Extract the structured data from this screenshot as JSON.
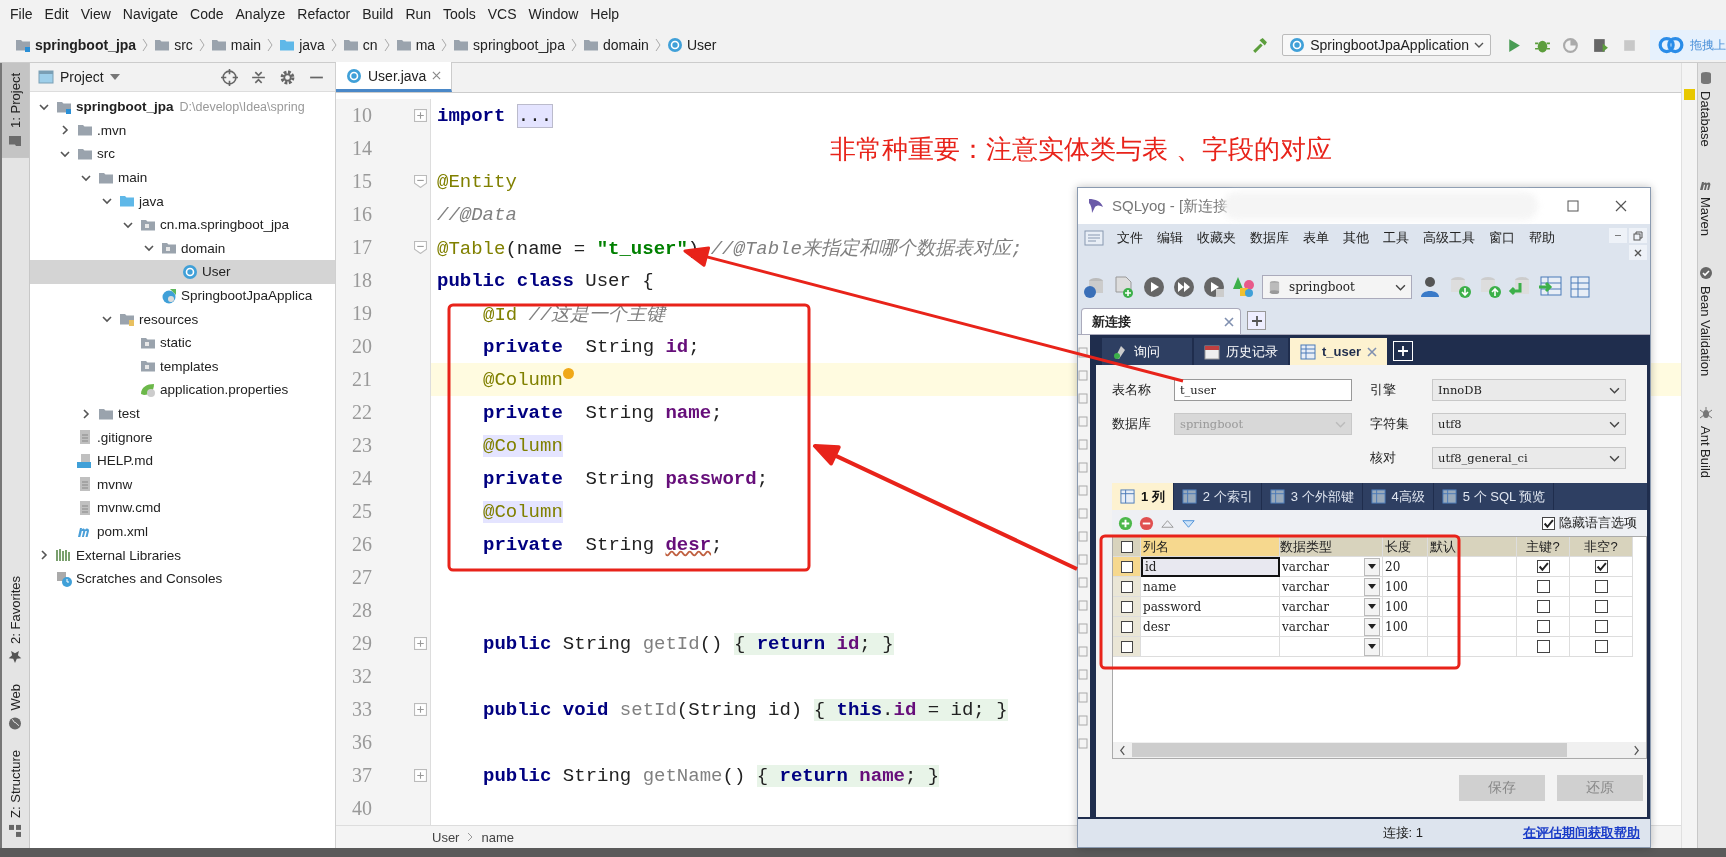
{
  "menu": [
    "File",
    "Edit",
    "View",
    "Navigate",
    "Code",
    "Analyze",
    "Refactor",
    "Build",
    "Run",
    "Tools",
    "VCS",
    "Window",
    "Help"
  ],
  "breadcrumbs": [
    {
      "label": "springboot_jpa",
      "kind": "module"
    },
    {
      "label": "src",
      "kind": "folder"
    },
    {
      "label": "main",
      "kind": "folder"
    },
    {
      "label": "java",
      "kind": "source"
    },
    {
      "label": "cn",
      "kind": "folder"
    },
    {
      "label": "ma",
      "kind": "folder"
    },
    {
      "label": "springboot_jpa",
      "kind": "folder"
    },
    {
      "label": "domain",
      "kind": "folder"
    },
    {
      "label": "User",
      "kind": "class"
    }
  ],
  "run_config": "SpringbootJpaApplication",
  "upload_widget": "拖拽上",
  "left_toolbar": {
    "top": [
      {
        "label": "1: Project",
        "selected": true,
        "kind": "folder"
      }
    ],
    "bottom": [
      {
        "label": "2: Favorites",
        "selected": false,
        "kind": "star"
      },
      {
        "label": "Web",
        "selected": false,
        "kind": "globe"
      },
      {
        "label": "Z: Structure",
        "selected": false,
        "kind": "structure"
      }
    ]
  },
  "project": {
    "title": "Project",
    "tree": [
      {
        "label": "springboot_jpa",
        "kind": "module",
        "hint": "D:\\develop\\Idea\\spring",
        "expanded": true,
        "selected": false,
        "children": [
          {
            "label": ".mvn",
            "kind": "folder",
            "expanded": false,
            "selected": false
          },
          {
            "label": "src",
            "kind": "folder",
            "expanded": true,
            "selected": false,
            "children": [
              {
                "label": "main",
                "kind": "folder",
                "expanded": true,
                "selected": false,
                "children": [
                  {
                    "label": "java",
                    "kind": "source",
                    "expanded": true,
                    "selected": false,
                    "children": [
                      {
                        "label": "cn.ma.springboot_jpa",
                        "kind": "package",
                        "expanded": true,
                        "selected": false,
                        "children": [
                          {
                            "label": "domain",
                            "kind": "package",
                            "expanded": true,
                            "selected": false,
                            "children": [
                              {
                                "label": "User",
                                "kind": "class",
                                "selected": true
                              }
                            ]
                          },
                          {
                            "label": "SpringbootJpaApplica",
                            "kind": "spring-class",
                            "selected": false
                          }
                        ]
                      }
                    ]
                  },
                  {
                    "label": "resources",
                    "kind": "resources",
                    "expanded": true,
                    "selected": false,
                    "children": [
                      {
                        "label": "static",
                        "kind": "package",
                        "selected": false
                      },
                      {
                        "label": "templates",
                        "kind": "package",
                        "selected": false
                      },
                      {
                        "label": "application.properties",
                        "kind": "properties",
                        "selected": false
                      }
                    ]
                  }
                ]
              },
              {
                "label": "test",
                "kind": "folder",
                "expanded": false,
                "selected": false
              }
            ]
          },
          {
            "label": ".gitignore",
            "kind": "file",
            "selected": false
          },
          {
            "label": "HELP.md",
            "kind": "md",
            "selected": false
          },
          {
            "label": "mvnw",
            "kind": "file",
            "selected": false
          },
          {
            "label": "mvnw.cmd",
            "kind": "file",
            "selected": false
          },
          {
            "label": "pom.xml",
            "kind": "maven",
            "selected": false
          }
        ]
      },
      {
        "label": "External Libraries",
        "kind": "libraries",
        "expanded": false,
        "selected": false
      },
      {
        "label": "Scratches and Consoles",
        "kind": "scratches",
        "selected": false
      }
    ]
  },
  "editor": {
    "tab": "User.java",
    "lines": [
      {
        "number": "10",
        "kind": "top",
        "folded": true,
        "current": false,
        "tokens": [
          {
            "text": "import ",
            "kind": "keyword"
          },
          {
            "text": "...",
            "kind": "folded"
          }
        ]
      },
      {
        "number": "14",
        "kind": "top",
        "current": false
      },
      {
        "number": "15",
        "kind": "top",
        "folded": false,
        "current": false,
        "tokens": [
          {
            "text": "@Entity",
            "kind": "annotation"
          }
        ]
      },
      {
        "number": "16",
        "kind": "top",
        "current": false,
        "tokens": [
          {
            "text": "//@Data",
            "kind": "comment"
          }
        ]
      },
      {
        "number": "17",
        "kind": "top",
        "folded": false,
        "current": false,
        "tokens": [
          {
            "text": "@Table",
            "kind": "annotation"
          },
          {
            "text": "(name = ",
            "kind": "plain"
          },
          {
            "text": "\"t_user\"",
            "kind": "string"
          },
          {
            "text": ") ",
            "kind": "plain"
          },
          {
            "text": "//@Table来指定和哪个数据表对应;",
            "kind": "comment"
          }
        ]
      },
      {
        "number": "18",
        "kind": "top",
        "current": false,
        "tokens": [
          {
            "text": "public class ",
            "kind": "keyword"
          },
          {
            "text": "User {",
            "kind": "plain"
          }
        ]
      },
      {
        "number": "19",
        "kind": "member",
        "current": false,
        "tokens": [
          {
            "text": "@Id ",
            "kind": "annotation"
          },
          {
            "text": "//这是一个主键",
            "kind": "comment"
          }
        ]
      },
      {
        "number": "20",
        "kind": "member",
        "current": false,
        "tokens": [
          {
            "text": "private ",
            "kind": "keyword"
          },
          {
            "text": " String ",
            "kind": "plain"
          },
          {
            "text": "id",
            "kind": "field"
          },
          {
            "text": ";",
            "kind": "plain"
          }
        ]
      },
      {
        "number": "21",
        "kind": "member",
        "current": true,
        "bulb": true,
        "tokens": [
          {
            "text": "@Column",
            "kind": "annotation"
          }
        ]
      },
      {
        "number": "22",
        "kind": "member",
        "current": false,
        "tokens": [
          {
            "text": "private ",
            "kind": "keyword"
          },
          {
            "text": " String ",
            "kind": "plain"
          },
          {
            "text": "name",
            "kind": "field"
          },
          {
            "text": ";",
            "kind": "plain"
          }
        ]
      },
      {
        "number": "23",
        "kind": "member",
        "current": false,
        "tokens": [
          {
            "text": "@Column",
            "kind": "usage"
          }
        ]
      },
      {
        "number": "24",
        "kind": "member",
        "current": false,
        "tokens": [
          {
            "text": "private ",
            "kind": "keyword"
          },
          {
            "text": " String ",
            "kind": "plain"
          },
          {
            "text": "password",
            "kind": "field"
          },
          {
            "text": ";",
            "kind": "plain"
          }
        ]
      },
      {
        "number": "25",
        "kind": "member",
        "current": false,
        "tokens": [
          {
            "text": "@Column",
            "kind": "usage"
          }
        ]
      },
      {
        "number": "26",
        "kind": "member",
        "current": false,
        "tokens": [
          {
            "text": "private ",
            "kind": "keyword"
          },
          {
            "text": " String ",
            "kind": "plain"
          },
          {
            "text": "desr",
            "kind": "typo"
          },
          {
            "text": ";",
            "kind": "plain"
          }
        ]
      },
      {
        "number": "27",
        "kind": "top",
        "current": false
      },
      {
        "number": "28",
        "kind": "top",
        "current": false
      },
      {
        "number": "29",
        "kind": "member",
        "folded": true,
        "current": false,
        "tokens": [
          {
            "text": "public ",
            "kind": "keyword"
          },
          {
            "text": "String ",
            "kind": "plain"
          },
          {
            "text": "getId",
            "kind": "unused"
          },
          {
            "text": "() ",
            "kind": "plain"
          }
        ],
        "body": [
          {
            "text": "{ ",
            "kind": "plain"
          },
          {
            "text": "return ",
            "kind": "keyword"
          },
          {
            "text": "id",
            "kind": "field"
          },
          {
            "text": "; }",
            "kind": "plain"
          }
        ]
      },
      {
        "number": "32",
        "kind": "top",
        "current": false
      },
      {
        "number": "33",
        "kind": "member",
        "folded": true,
        "current": false,
        "tokens": [
          {
            "text": "public void ",
            "kind": "keyword"
          },
          {
            "text": "setId",
            "kind": "unused"
          },
          {
            "text": "(String id) ",
            "kind": "plain"
          }
        ],
        "body": [
          {
            "text": "{ ",
            "kind": "plain"
          },
          {
            "text": "this",
            "kind": "keyword"
          },
          {
            "text": ".",
            "kind": "plain"
          },
          {
            "text": "id",
            "kind": "field"
          },
          {
            "text": " = id; }",
            "kind": "plain"
          }
        ]
      },
      {
        "number": "36",
        "kind": "top",
        "current": false
      },
      {
        "number": "37",
        "kind": "member",
        "folded": true,
        "current": false,
        "tokens": [
          {
            "text": "public ",
            "kind": "keyword"
          },
          {
            "text": "String ",
            "kind": "plain"
          },
          {
            "text": "getName",
            "kind": "unused"
          },
          {
            "text": "() ",
            "kind": "plain"
          }
        ],
        "body": [
          {
            "text": "{ ",
            "kind": "plain"
          },
          {
            "text": "return ",
            "kind": "keyword"
          },
          {
            "text": "name",
            "kind": "field"
          },
          {
            "text": "; }",
            "kind": "plain"
          }
        ]
      },
      {
        "number": "40",
        "kind": "top",
        "current": false
      }
    ],
    "breadcrumb": [
      "User",
      "name"
    ]
  },
  "annotation": "非常种重要：注意实体类与表 、字段的对应",
  "right_toolbar": [
    {
      "label": "Database",
      "kind": "database"
    },
    {
      "label": "Maven",
      "kind": "maven"
    },
    {
      "label": "Bean Validation",
      "kind": "bean"
    },
    {
      "label": "Ant Build",
      "kind": "ant"
    }
  ],
  "sqlyog": {
    "title": "SQLyog - [新连接",
    "menu": [
      "文件",
      "编辑",
      "收藏夹",
      "数据库",
      "表单",
      "其他",
      "工具",
      "高级工具",
      "窗口",
      "帮助"
    ],
    "database": "springboot",
    "connection_tab": "新连接",
    "tabs": [
      {
        "label": "询问",
        "selected": false,
        "kind": "query"
      },
      {
        "label": "历史记录",
        "selected": false,
        "kind": "history"
      },
      {
        "label": "t_user",
        "selected": true,
        "kind": "table"
      }
    ],
    "form": {
      "table_name_label": "表名称",
      "table_name": "t_user",
      "database_label": "数据库",
      "database": "springboot",
      "engine_label": "引擎",
      "engine": "InnoDB",
      "charset_label": "字符集",
      "charset": "utf8",
      "collation_label": "核对",
      "collation": "utf8_general_ci"
    },
    "subtabs": [
      {
        "label": "1 列",
        "selected": true
      },
      {
        "label": "2 个索引",
        "selected": false
      },
      {
        "label": "3 个外部键",
        "selected": false
      },
      {
        "label": "4高级",
        "selected": false
      },
      {
        "label": "5 个 SQL 预览",
        "selected": false
      }
    ],
    "hide_language_options": {
      "label": "隐藏语言选项",
      "checked": true
    },
    "select_all": {
      "checked": false
    },
    "columns": [
      "列名",
      "数据类型",
      "长度",
      "默认",
      "主键?",
      "非空?"
    ],
    "rows": [
      {
        "checked": false,
        "focused": true,
        "name": "id",
        "type": "varchar",
        "length": "20",
        "primary_key": true,
        "not_null": true
      },
      {
        "checked": false,
        "focused": false,
        "name": "name",
        "type": "varchar",
        "length": "100",
        "primary_key": false,
        "not_null": false
      },
      {
        "checked": false,
        "focused": false,
        "name": "password",
        "type": "varchar",
        "length": "100",
        "primary_key": false,
        "not_null": false
      },
      {
        "checked": false,
        "focused": false,
        "name": "desr",
        "type": "varchar",
        "length": "100",
        "primary_key": false,
        "not_null": false
      },
      {
        "checked": false,
        "focused": false,
        "primary_key": false,
        "not_null": false
      }
    ],
    "buttons": [
      "保存",
      "还原"
    ],
    "status": "连接: 1",
    "help_link": "在评估期间获取帮助"
  }
}
